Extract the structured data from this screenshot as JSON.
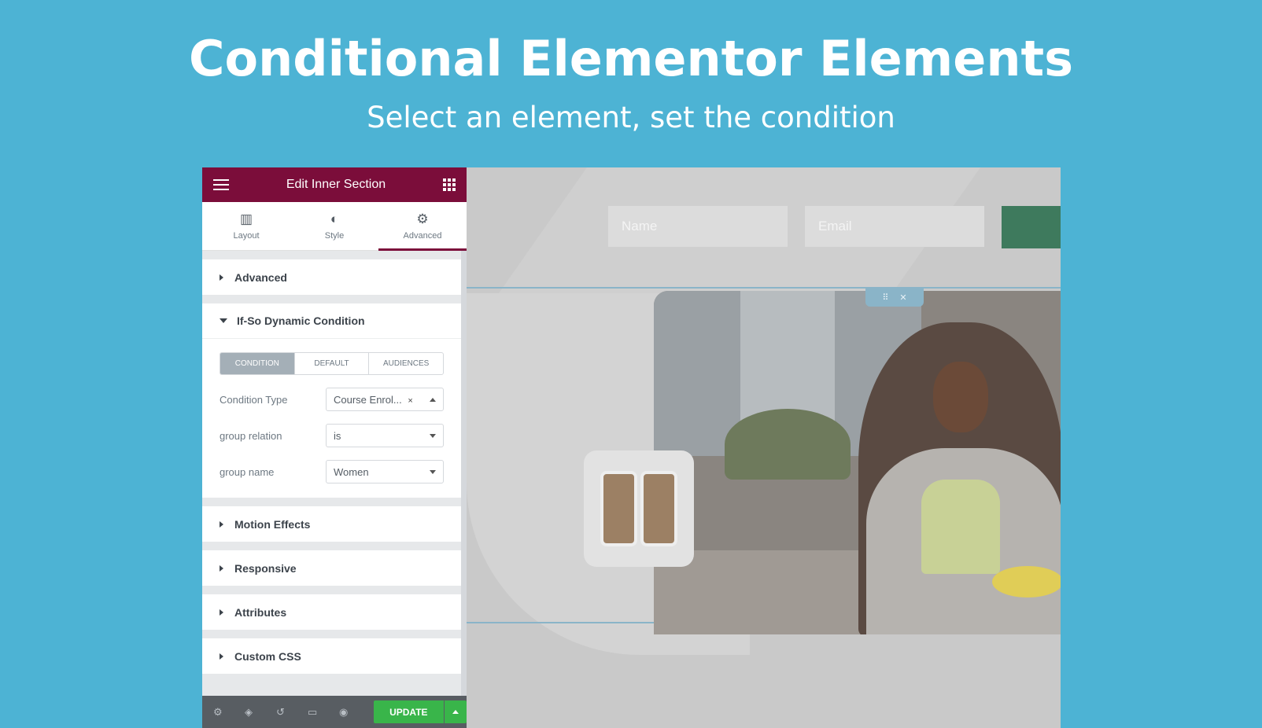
{
  "hero": {
    "title": "Conditional Elementor Elements",
    "subtitle": "Select an element, set the condition"
  },
  "panel": {
    "header_title": "Edit Inner Section",
    "tabs": [
      {
        "label": "Layout",
        "icon": "layout-icon"
      },
      {
        "label": "Style",
        "icon": "style-icon"
      },
      {
        "label": "Advanced",
        "icon": "gear-icon",
        "active": true
      }
    ],
    "sections": {
      "advanced": "Advanced",
      "ifso": "If-So Dynamic Condition",
      "motion": "Motion Effects",
      "responsive": "Responsive",
      "attributes": "Attributes",
      "custom_css": "Custom CSS"
    },
    "ifso": {
      "segments": [
        "CONDITION",
        "DEFAULT",
        "AUDIENCES"
      ],
      "active_segment": "CONDITION",
      "condition_type_label": "Condition Type",
      "condition_type_value": "Course Enrol...",
      "group_relation_label": "group relation",
      "group_relation_value": "is",
      "group_name_label": "group name",
      "group_name_value": "Women"
    },
    "footer": {
      "update_label": "UPDATE"
    }
  },
  "canvas": {
    "name_placeholder": "Name",
    "email_placeholder": "Email"
  },
  "colors": {
    "background": "#4db3d4",
    "header": "#7b0d3a",
    "update_button": "#39b54a"
  }
}
